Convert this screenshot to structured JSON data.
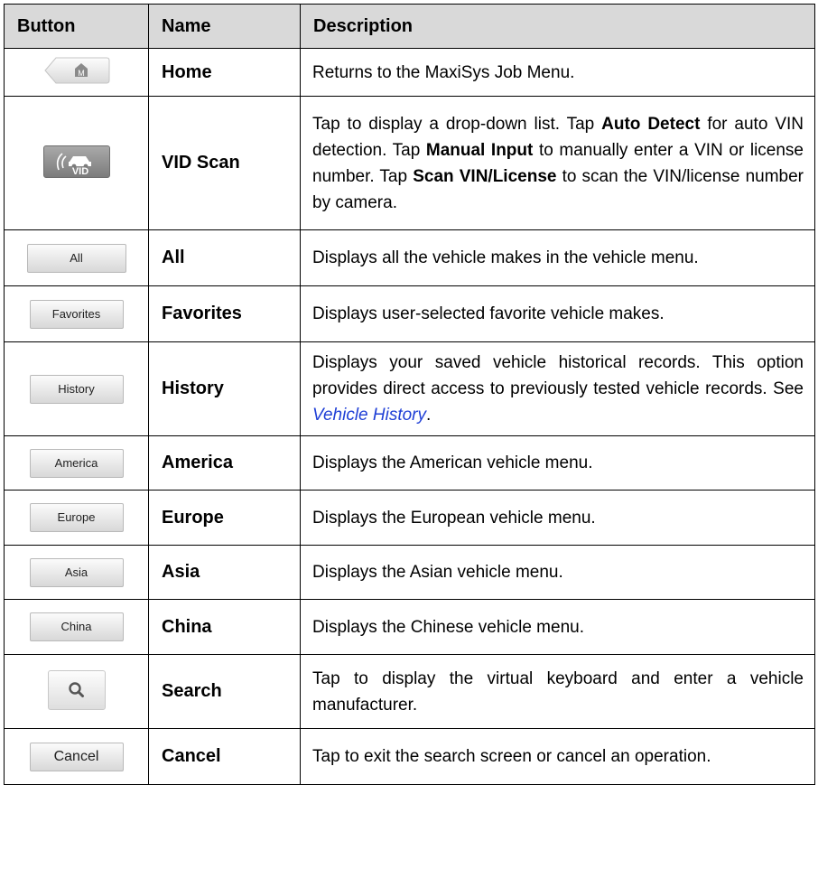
{
  "headers": {
    "button": "Button",
    "name": "Name",
    "description": "Description"
  },
  "rows": [
    {
      "icon": "home-m-icon",
      "name": "Home",
      "desc": [
        {
          "t": "Returns to the MaxiSys Job Menu."
        }
      ]
    },
    {
      "icon": "vid-scan-icon",
      "name": "VID Scan",
      "desc": [
        {
          "t": "Tap to display a drop-down list. Tap "
        },
        {
          "t": "Auto Detect",
          "b": true
        },
        {
          "t": " for auto VIN detection. Tap "
        },
        {
          "t": "Manual Input",
          "b": true
        },
        {
          "t": " to manually enter a VIN or license number. Tap "
        },
        {
          "t": "Scan VIN/License",
          "b": true
        },
        {
          "t": " to scan the VIN/license number by camera."
        }
      ]
    },
    {
      "button_label": "All",
      "name": "All",
      "desc": [
        {
          "t": "Displays all the vehicle makes in the vehicle menu."
        }
      ]
    },
    {
      "button_label": "Favorites",
      "name": "Favorites",
      "desc": [
        {
          "t": "Displays user-selected favorite vehicle makes."
        }
      ]
    },
    {
      "button_label": "History",
      "name": "History",
      "desc": [
        {
          "t": "Displays your saved vehicle historical records. This option provides direct access to previously tested vehicle records. See "
        },
        {
          "t": "Vehicle History",
          "link": true
        },
        {
          "t": "."
        }
      ]
    },
    {
      "button_label": "America",
      "name": "America",
      "desc": [
        {
          "t": "Displays the American vehicle menu."
        }
      ]
    },
    {
      "button_label": "Europe",
      "name": "Europe",
      "desc": [
        {
          "t": "Displays the European vehicle menu."
        }
      ]
    },
    {
      "button_label": "Asia",
      "name": "Asia",
      "desc": [
        {
          "t": "Displays the Asian vehicle menu."
        }
      ]
    },
    {
      "button_label": "China",
      "name": "China",
      "desc": [
        {
          "t": "Displays the Chinese vehicle menu."
        }
      ]
    },
    {
      "icon": "search-icon",
      "name": "Search",
      "desc": [
        {
          "t": "Tap to display the virtual keyboard and enter a vehicle manufacturer."
        }
      ]
    },
    {
      "button_label": "Cancel",
      "name": "Cancel",
      "desc": [
        {
          "t": "Tap to exit the search screen or cancel an operation."
        }
      ]
    }
  ]
}
